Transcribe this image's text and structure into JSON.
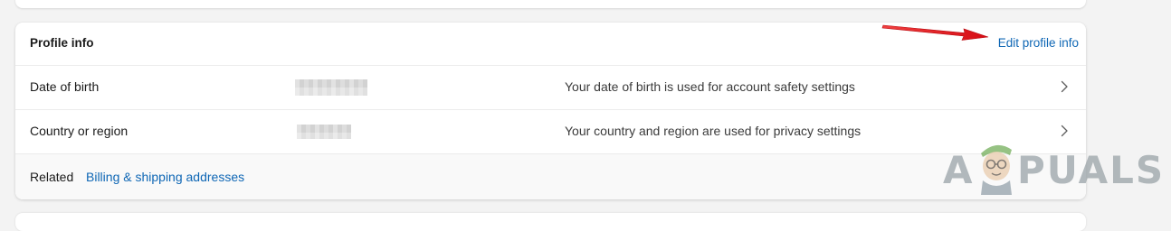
{
  "profile_card": {
    "title": "Profile info",
    "edit_link": "Edit profile info",
    "rows": [
      {
        "label": "Date of birth",
        "value": "",
        "description": "Your date of birth is used for account safety settings"
      },
      {
        "label": "Country or region",
        "value": "",
        "description": "Your country and region are used for privacy settings"
      }
    ],
    "related": {
      "label": "Related",
      "link": "Billing & shipping addresses"
    }
  },
  "annotation": {
    "arrow_color": "#e8141c",
    "arrow_points_to": "edit-profile-info-link"
  },
  "watermark": {
    "letter_a": "A",
    "rest": "PUALS"
  },
  "colors": {
    "link": "#0f67b5",
    "background": "#f3f3f3",
    "card": "#ffffff",
    "footer": "#f9f9f9"
  },
  "icons": {
    "row_chevron": "chevron-right-icon",
    "arrow": "red-arrow-icon"
  }
}
